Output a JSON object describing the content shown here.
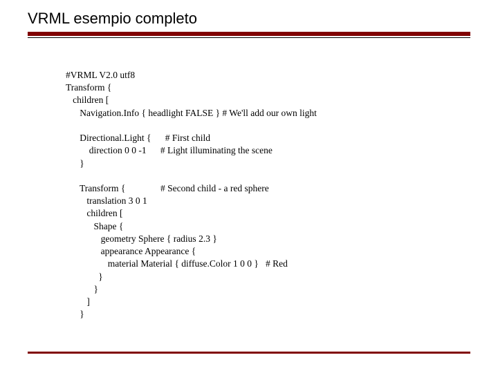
{
  "title": "VRML esempio completo",
  "code": "#VRML V2.0 utf8\nTransform {\n   children [\n      Navigation.Info { headlight FALSE } # We'll add our own light\n\n      Directional.Light {      # First child\n          direction 0 0 -1      # Light illuminating the scene\n      }\n\n      Transform {               # Second child - a red sphere\n         translation 3 0 1\n         children [\n            Shape {\n               geometry Sphere { radius 2.3 }\n               appearance Appearance {\n                  material Material { diffuse.Color 1 0 0 }   # Red\n              }\n            }\n         ]\n      }"
}
